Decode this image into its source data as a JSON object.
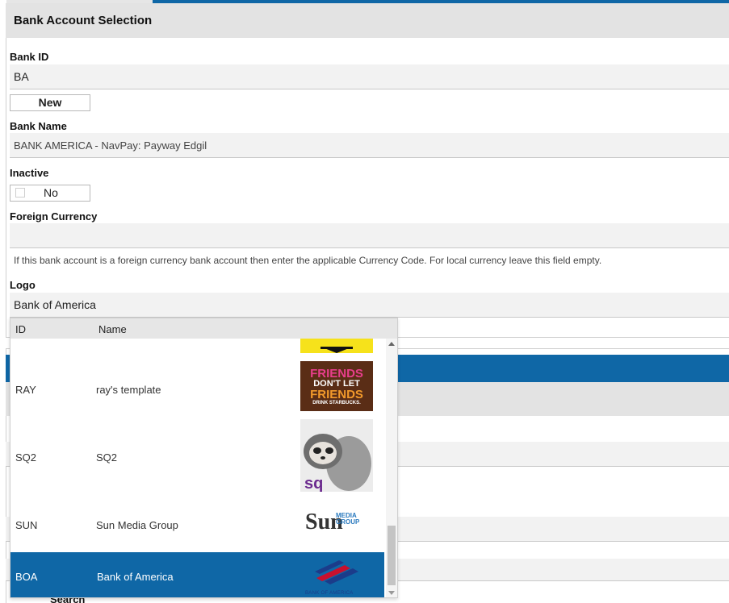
{
  "section": {
    "title": "Bank Account Selection"
  },
  "fields": {
    "bank_id_label": "Bank ID",
    "bank_id_value": "BA",
    "new_button": "New",
    "bank_name_label": "Bank Name",
    "bank_name_value": "BANK AMERICA - NavPay: Payway Edgil",
    "inactive_label": "Inactive",
    "inactive_value": "No",
    "foreign_currency_label": "Foreign Currency",
    "foreign_currency_value": "",
    "foreign_currency_help": "If this bank account is a foreign currency bank account then enter the applicable Currency Code. For local currency leave this field empty.",
    "logo_label": "Logo",
    "logo_value": "Bank of America"
  },
  "dropdown": {
    "columns": {
      "id": "ID",
      "name": "Name"
    },
    "rows": [
      {
        "id": "RAY",
        "name": "ray's template",
        "logo": "friends-dont-let-friends-logo"
      },
      {
        "id": "SQ2",
        "name": "SQ2",
        "logo": "sloth-sq-logo"
      },
      {
        "id": "SUN",
        "name": "Sun Media Group",
        "logo": "sun-media-group-logo"
      },
      {
        "id": "BOA",
        "name": "Bank of America",
        "logo": "bank-of-america-logo"
      }
    ],
    "selected": "BOA",
    "logo_text": {
      "friends_1": "FRIENDS",
      "friends_2": "DON'T LET",
      "friends_3": "FRIENDS",
      "friends_4": "DRINK STARBUCKS.",
      "sq": "sq",
      "sun": "Sun",
      "sun_media": "MEDIA",
      "sun_group": "GROUP",
      "boa": "BANK OF AMERICA"
    }
  },
  "background": {
    "search_label": "Search"
  },
  "colors": {
    "accent": "#0f67a6",
    "header_bg": "#e3e3e3",
    "field_bg": "#f2f2f2"
  }
}
